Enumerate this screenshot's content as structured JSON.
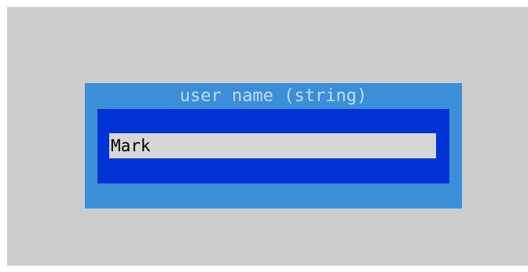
{
  "dialog": {
    "title": "user name (string)",
    "input": {
      "value": "Mark"
    }
  },
  "colors": {
    "background": "#cdcdcd",
    "dialog_frame": "#3b8fd8",
    "dialog_body": "#0033d6",
    "title_text": "#c4dbef",
    "input_background": "#d6d6d6"
  }
}
